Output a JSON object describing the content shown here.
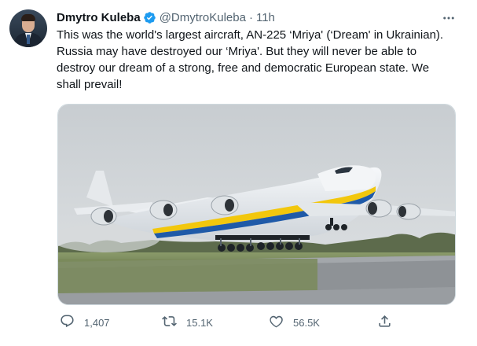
{
  "author": {
    "display_name": "Dmytro Kuleba",
    "handle": "@DmytroKuleba",
    "separator": "·",
    "time": "11h"
  },
  "tweet": {
    "lines": [
      "This was the world's largest aircraft, AN-225 ‘Mriya' (‘Dream' in Ukrainian).",
      "Russia may have destroyed our ‘Mriya'. But they will never be able to",
      "destroy our dream of a strong, free and democratic European state. We",
      "shall prevail!"
    ]
  },
  "media": {
    "subject": "AN-225 Mriya aircraft taking off from runway",
    "livery_colors": {
      "yellow": "#f2c70d",
      "blue": "#1f5aa8",
      "fuselage": "#eef1f4"
    }
  },
  "actions": {
    "replies": "1,407",
    "retweets": "15.1K",
    "likes": "56.5K"
  },
  "colors": {
    "text": "#0f1419",
    "secondary": "#536471",
    "verified": "#1d9bf0",
    "border": "#cfd9de"
  },
  "icons": [
    "verified-badge-icon",
    "more-icon",
    "reply-icon",
    "retweet-icon",
    "like-icon",
    "share-icon"
  ]
}
